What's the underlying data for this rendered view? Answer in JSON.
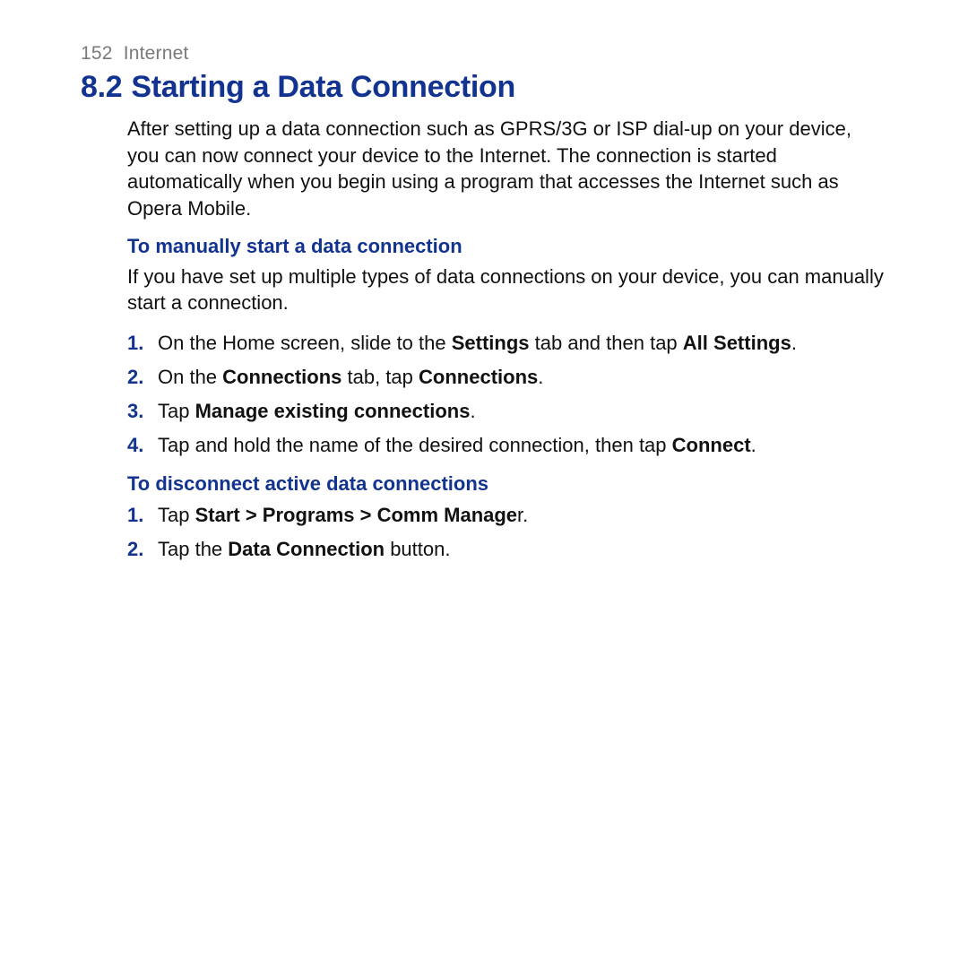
{
  "header": {
    "page_number": "152",
    "chapter": "Internet"
  },
  "section": {
    "number": "8.2",
    "title": "Starting a Data Connection"
  },
  "intro": "After setting up a data connection such as GPRS/3G or ISP dial-up on your device, you can now connect your device to the Internet. The connection is started automatically when you begin using a program that accesses the Internet such as Opera Mobile.",
  "sub1": {
    "heading": "To manually start a data connection",
    "lead": "If you have set up multiple types of data connections on your device, you can manually start a connection.",
    "steps": {
      "s1": {
        "marker": "1.",
        "t1": "On the Home screen, slide to the ",
        "b1": "Settings",
        "t2": " tab and then tap ",
        "b2": "All Settings",
        "t3": "."
      },
      "s2": {
        "marker": "2.",
        "t1": "On the ",
        "b1": "Connections",
        "t2": " tab, tap ",
        "b2": "Connections",
        "t3": "."
      },
      "s3": {
        "marker": "3.",
        "t1": "Tap ",
        "b1": "Manage existing connections",
        "t2": "."
      },
      "s4": {
        "marker": "4.",
        "t1": "Tap and hold the name of the desired connection, then tap ",
        "b1": "Connect",
        "t2": "."
      }
    }
  },
  "sub2": {
    "heading": "To disconnect active data connections",
    "steps": {
      "s1": {
        "marker": "1.",
        "t1": "Tap ",
        "b1": "Start > Programs > Comm Manage",
        "t2": "r."
      },
      "s2": {
        "marker": "2.",
        "t1": "Tap the ",
        "b1": "Data Connection",
        "t2": " button."
      }
    }
  }
}
